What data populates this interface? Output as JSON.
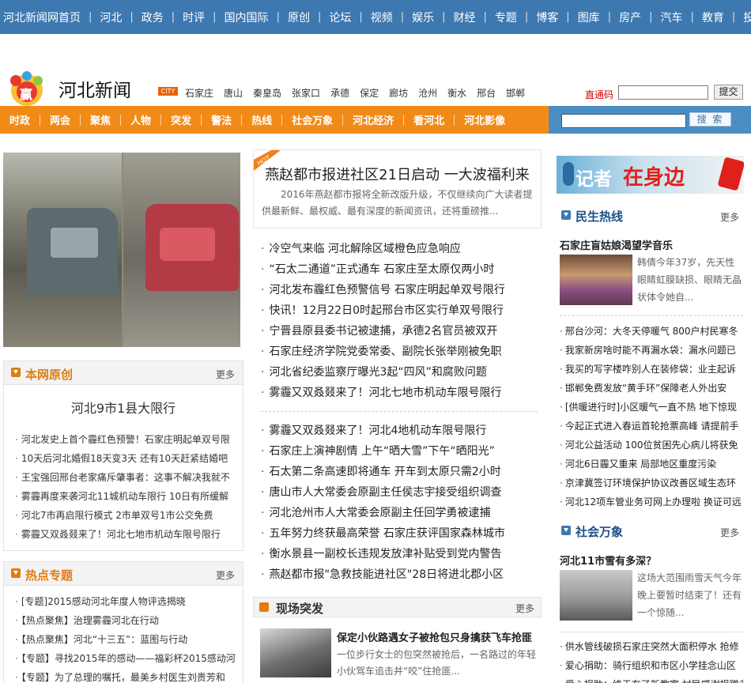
{
  "top_nav": [
    "河北新闻网首页",
    "河北",
    "政务",
    "时评",
    "国内国际",
    "原创",
    "论坛",
    "视频",
    "娱乐",
    "财经",
    "专题",
    "博客",
    "图库",
    "房产",
    "汽车",
    "教育",
    "投诉"
  ],
  "logo": {
    "text": "河北新闻",
    "badge": "赢"
  },
  "city_tag": "CITY",
  "cities": [
    "石家庄",
    "唐山",
    "秦皇岛",
    "张家口",
    "承德",
    "保定",
    "廊坊",
    "沧州",
    "衡水",
    "邢台",
    "邯郸"
  ],
  "code": {
    "label": "直通码",
    "value": "",
    "button": "提交"
  },
  "main_nav": [
    "时政",
    "两会",
    "聚焦",
    "人物",
    "突发",
    "警法",
    "热线",
    "社会万象",
    "河北经济",
    "看河北",
    "河北影像"
  ],
  "search": {
    "value": "",
    "button": "搜 索"
  },
  "original": {
    "title": "本网原创",
    "more": "更多",
    "headline": "河北9市1县大限行",
    "items": [
      "河北发史上首个霾红色预警！石家庄明起单双号限",
      "10天后河北婚假18天变3天 还有10天赶紧结婚吧",
      "王宝强回邢台老家痛斥肇事者：这事不解决我就不",
      "雾霾再度来袭河北11城机动车限行 10日有所缓解",
      "河北7市再启限行模式 2市单双号1市公交免费",
      "雾霾又双叒叕来了！河北七地市机动车限号限行"
    ]
  },
  "hot_topics": {
    "title": "热点专题",
    "more": "更多",
    "items": [
      "[专题]2015感动河北年度人物评选揭晓",
      "【热点聚焦】治理雾霾河北在行动",
      "【热点聚焦】河北“十三五”：蓝图与行动",
      "【专题】寻找2015年的感动——福彩杯2015感动河",
      "【专题】为了总理的嘱托，最美乡村医生刘贵芳和"
    ]
  },
  "feature": {
    "hot": "HOT",
    "headline": "燕赵都市报进社区21日启动 一大波福利来",
    "summary": "2016年燕赵都市报将全新改版升级，不仅继续向广大读者提供最新鲜、最权威、最有深度的新闻资讯，还将重磅推..."
  },
  "news_group1": [
    "冷空气来临 河北解除区域橙色应急响应",
    "“石太二通道”正式通车 石家庄至太原仅两小时",
    "河北发布霾红色预警信号 石家庄明起单双号限行",
    "快讯！12月22日0时起邢台市区实行单双号限行",
    "宁晋县原县委书记被逮捕，承德2名官员被双开",
    "石家庄经济学院党委常委、副院长张举刚被免职",
    "河北省纪委监察厅曝光3起“四风”和腐败问题",
    "雾霾又双叒叕来了！河北七地市机动车限号限行"
  ],
  "news_group2": [
    "雾霾又双叒叕来了！河北4地机动车限号限行",
    "石家庄上演神剧情 上午“晒大雪”下午“晒阳光”",
    "石太第二条高速即将通车 开车到太原只需2小时",
    "唐山市人大常委会原副主任侯志宇接受组织调查",
    "河北沧州市人大常委会原副主任回学勇被逮捕",
    "五年努力终获最高荣誉 石家庄获评国家森林城市",
    "衡水景县一副校长违规发放津补贴受到党内警告",
    "燕赵都市报\"急救技能进社区\"28日将进北郡小区"
  ],
  "scene": {
    "title": "现场突发",
    "more": "更多",
    "story_title": "保定小伙路遇女子被抢包只身擒获飞车抢匪",
    "story_text": "一位步行女士的包突然被抢后，一名路过的年轻小伙驾车追击并“咬”住抢匪..."
  },
  "banner": {
    "text1": "记者",
    "text2": "在身边"
  },
  "livelihood": {
    "title": "民生热线",
    "more": "更多",
    "story_title": "石家庄盲姑娘渴望学音乐",
    "story_text": "韩倩今年37岁，先天性眼睛虹膜缺损、眼睛无晶状体令她自...",
    "items": [
      "邢台沙河：大冬天停暖气 800户村民寒冬",
      "我家新房啥时能不再漏水袋：漏水问题已",
      "我买的写字楼咋别人在装修袋：业主起诉",
      "邯郸免费发放“黄手环”保障老人外出安",
      "[供暖进行时]小区暖气一直不热 地下惊现",
      "今起正式进入春运首轮抢票高峰 请提前手",
      "河北公益活动 100位贫困先心病儿将获免",
      "河北6日霾又重来 局部地区重度污染",
      "京津冀签订环境保护协议改善区域生态环",
      "河北12项车管业务可网上办理啦 换证可远"
    ]
  },
  "society": {
    "title": "社会万象",
    "more": "更多",
    "story_title": "河北11市雪有多深？",
    "story_text": "这场大范围雨雪天气今年晚上要暂时结束了！还有一个惊随...",
    "items": [
      "供水管线破损石家庄突然大面积停水 抢修",
      "爱心捐助：骑行组织和市区小学挂念山区",
      "爱心捐助：终于有了新教室 村民感谢捐赠者"
    ]
  }
}
